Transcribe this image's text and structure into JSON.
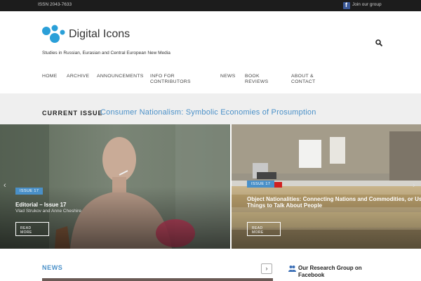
{
  "topbar": {
    "issn": "ISSN 2043-7633",
    "facebook_letter": "f",
    "join_label": "Join our group"
  },
  "header": {
    "site_title": "Digital Icons",
    "tagline": "Studies in Russian, Eurasian and Central European New Media",
    "search_icon": "search-icon"
  },
  "nav": {
    "items": [
      {
        "line1": "Home",
        "line2": ""
      },
      {
        "line1": "Archive",
        "line2": ""
      },
      {
        "line1": "Announcements",
        "line2": ""
      },
      {
        "line1": "Info for",
        "line2": "Contributors"
      },
      {
        "line1": "News",
        "line2": ""
      },
      {
        "line1": "Book",
        "line2": "Reviews"
      },
      {
        "line1": "About &",
        "line2": "Contact"
      }
    ]
  },
  "current_issue": {
    "label": "CURRENT ISSUE",
    "title": "Consumer Nationalism: Symbolic Economies of Prosumption"
  },
  "slides": [
    {
      "badge": "ISSUE 17",
      "title": "Editorial – Issue 17",
      "subtitle": "Vlad Strukov and Anne Cheshire",
      "read_more_line1": "READ",
      "read_more_line2": "MORE"
    },
    {
      "badge": "ISSUE 17",
      "title_line1": "Object Nationalities: Connecting Nations and Commodities, or Using",
      "title_line2": "Things to Talk About People",
      "read_more_line1": "READ",
      "read_more_line2": "MORE"
    }
  ],
  "carousel": {
    "prev": "‹",
    "next": "›"
  },
  "news": {
    "label": "NEWS",
    "next": "›"
  },
  "sidebar": {
    "group_title": "Our Research Group on Facebook"
  },
  "colors": {
    "accent": "#4a90c8",
    "topbar": "#1c1c1c",
    "band": "#efefef",
    "facebook": "#3b5998"
  }
}
